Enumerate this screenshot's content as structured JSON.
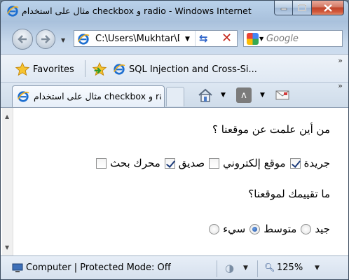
{
  "window": {
    "title": "مثال على استخدام checkbox و radio - Windows Internet Explorer"
  },
  "address_bar": {
    "url": "C:\\Users\\Mukhtar\\Desktop\\checkbox.html",
    "search_placeholder": "Google"
  },
  "favorites_bar": {
    "favorites_label": "Favorites",
    "items": [
      {
        "label": "SQL Injection and Cross-Si..."
      }
    ]
  },
  "tabs": [
    {
      "label": "مثال على استخدام checkbox و radio..."
    }
  ],
  "page": {
    "question1": "من أين علمت عن موقعنا ؟",
    "checkboxes": [
      {
        "label": "جريدة",
        "checked": true
      },
      {
        "label": "موقع إلكتروني",
        "checked": false
      },
      {
        "label": "صديق",
        "checked": true
      },
      {
        "label": "محرك بحث",
        "checked": false
      }
    ],
    "question2": "ما تقييمك لموقعنا؟",
    "radios": [
      {
        "label": "جيد",
        "checked": false
      },
      {
        "label": "متوسط",
        "checked": true
      },
      {
        "label": "سيء",
        "checked": false
      }
    ]
  },
  "status_bar": {
    "text": "Computer | Protected Mode: Off",
    "zoom": "125%"
  },
  "icons": {
    "ie": "ie-logo-icon",
    "back": "back-arrow-icon",
    "forward": "forward-arrow-icon",
    "refresh": "refresh-icon",
    "stop": "stop-icon",
    "favorites": "star-icon",
    "home": "home-icon",
    "feeds": "rss-feed-icon",
    "mail": "mail-icon"
  },
  "colors": {
    "ie_blue": "#1e6fd0",
    "radio_selected": "#1f4f9f",
    "stop_red": "#c5281c"
  }
}
